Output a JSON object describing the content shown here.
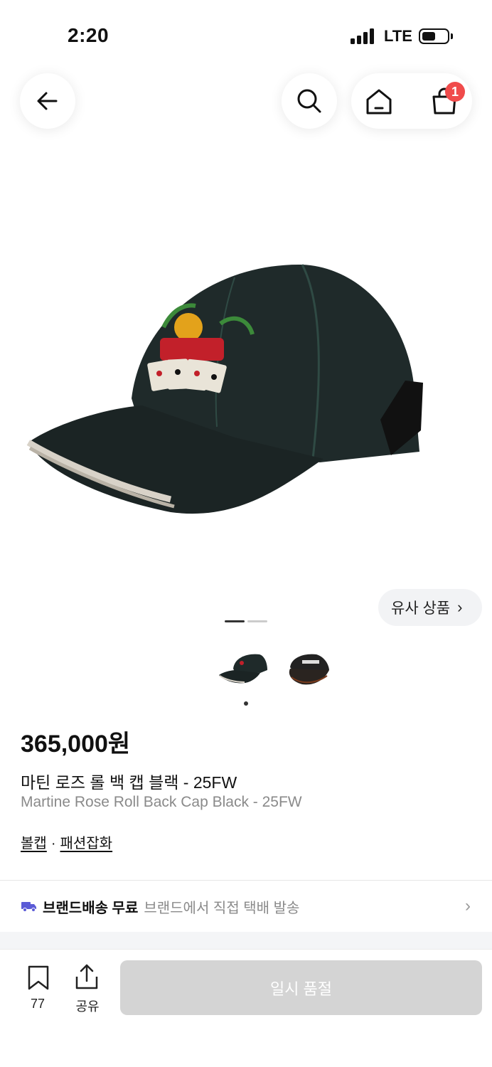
{
  "status_bar": {
    "time": "2:20",
    "network": "LTE"
  },
  "header": {
    "cart_count": "1"
  },
  "product": {
    "similar_label": "유사 상품",
    "price": "365,000원",
    "name_ko": "마틴 로즈 롤 백 캡 블랙 - 25FW",
    "name_en": "Martine Rose Roll Back Cap Black - 25FW",
    "categories": [
      "볼캡",
      "패션잡화"
    ],
    "category_separator": "·"
  },
  "shipping": {
    "bold": "브랜드배송 무료",
    "detail": "브랜드에서 직접 택배 발송"
  },
  "bottom_bar": {
    "bookmark_count": "77",
    "share_label": "공유",
    "soldout_label": "일시 품절"
  },
  "colors": {
    "badge": "#f04b4b",
    "truck": "#5b5bd6",
    "soldout_bg": "#d4d4d4"
  },
  "icons": [
    "back-arrow-icon",
    "search-icon",
    "home-icon",
    "cart-icon",
    "truck-icon",
    "chevron-right-icon",
    "bookmark-icon",
    "share-icon"
  ]
}
